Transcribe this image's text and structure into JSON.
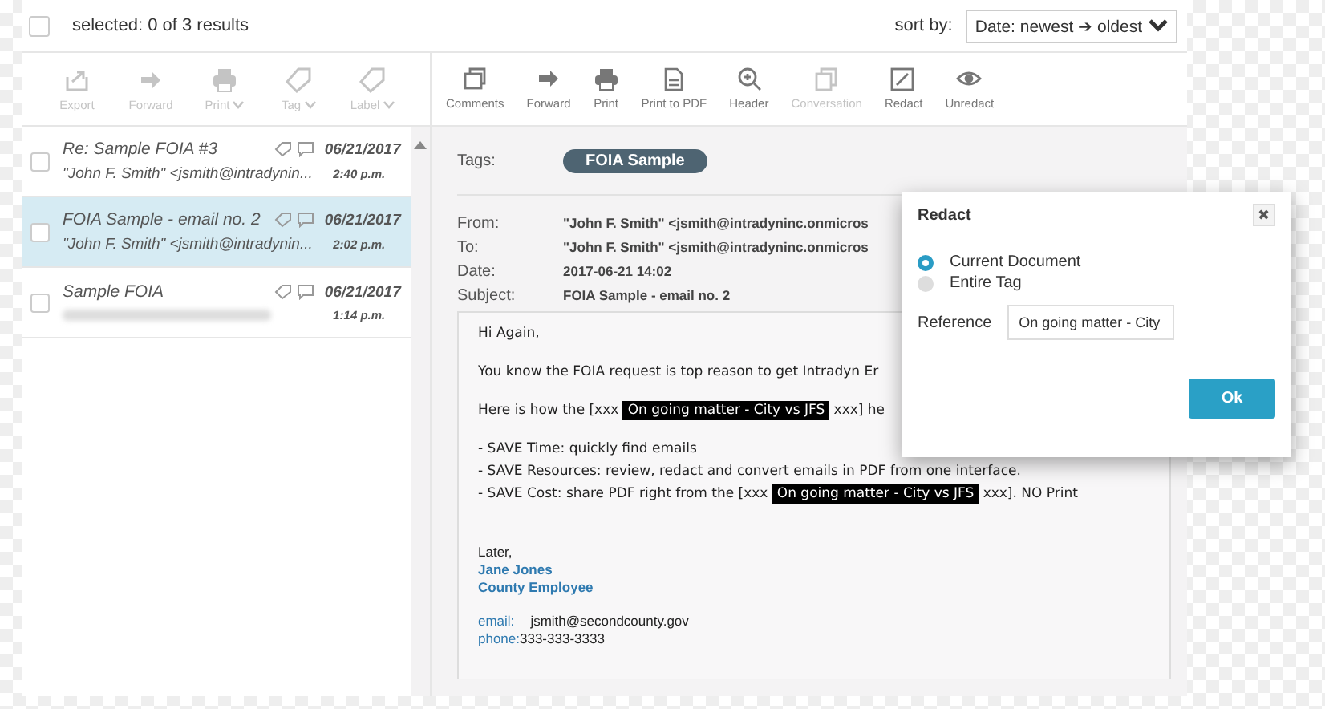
{
  "header": {
    "all_checked": false,
    "selection": "selected: 0 of 3 results",
    "sort_label": "sort by:",
    "sort_value": "Date: newest ➔ oldest"
  },
  "list_toolbar": [
    {
      "label": "Export",
      "disabled": true,
      "dropdown": false
    },
    {
      "label": "Forward",
      "disabled": true,
      "dropdown": false
    },
    {
      "label": "Print",
      "disabled": true,
      "dropdown": true
    },
    {
      "label": "Tag",
      "disabled": true,
      "dropdown": true
    },
    {
      "label": "Label",
      "disabled": true,
      "dropdown": true
    }
  ],
  "doc_toolbar": [
    {
      "label": "Comments",
      "disabled": false
    },
    {
      "label": "Forward",
      "disabled": false
    },
    {
      "label": "Print",
      "disabled": false
    },
    {
      "label": "Print to PDF",
      "disabled": false
    },
    {
      "label": "Header",
      "disabled": false
    },
    {
      "label": "Conversation",
      "disabled": true
    },
    {
      "label": "Redact",
      "disabled": false
    },
    {
      "label": "Unredact",
      "disabled": false
    }
  ],
  "emails": [
    {
      "subject": "Re: Sample FOIA #3",
      "sender": "\"John F. Smith\" <jsmith@intradynin...",
      "date": "06/21/2017",
      "time": "2:40 p.m.",
      "selected": false,
      "sender_blurred": false
    },
    {
      "subject": "FOIA Sample - email no. 2",
      "sender": "\"John F. Smith\" <jsmith@intradynin...",
      "date": "06/21/2017",
      "time": "2:02 p.m.",
      "selected": true,
      "sender_blurred": false
    },
    {
      "subject": "Sample FOIA",
      "date": "06/21/2017",
      "time": "1:14 p.m.",
      "selected": false,
      "sender_blurred": true
    }
  ],
  "document": {
    "tags_label": "Tags:",
    "tag": "FOIA Sample",
    "fields": [
      {
        "label": "From:",
        "value": "\"John F. Smith\" <jsmith@intradyninc.onmicros"
      },
      {
        "label": "To:",
        "value": "\"John F. Smith\" <jsmith@intradyninc.onmicros"
      },
      {
        "label": "Date:",
        "value": "2017-06-21 14:02"
      },
      {
        "label": "Subject:",
        "value": "FOIA Sample - email no. 2"
      }
    ],
    "body": [
      {
        "kind": "text",
        "parts": [
          {
            "text": "Hi Again,",
            "redacted": false
          }
        ]
      },
      {
        "kind": "text",
        "parts": [
          {
            "text": "You know the FOIA request is top reason to get Intradyn Er",
            "redacted": false
          }
        ]
      },
      {
        "kind": "text",
        "parts": [
          {
            "text": "Here is how the [xxx ",
            "redacted": false
          },
          {
            "text": "On going matter - City vs JFS",
            "redacted": true
          },
          {
            "text": " xxx] he",
            "redacted": false
          }
        ]
      },
      {
        "kind": "list",
        "items": [
          [
            {
              "text": "- SAVE Time: quickly find emails",
              "redacted": false
            }
          ],
          [
            {
              "text": "- SAVE Resources: review, redact and convert emails in PDF from one interface.",
              "redacted": false
            }
          ],
          [
            {
              "text": "- SAVE Cost: share PDF right from the [xxx ",
              "redacted": false
            },
            {
              "text": "On going matter - City vs JFS",
              "redacted": true
            },
            {
              "text": " xxx]. NO Print",
              "redacted": false
            }
          ]
        ]
      }
    ],
    "signature": {
      "closing": "Later,",
      "name": "Jane Jones",
      "title": "County Employee",
      "email_label": "email:",
      "email": "jsmith@secondcounty.gov",
      "phone_label": "phone:",
      "phone": "333-333-3333"
    }
  },
  "redact_dialog": {
    "title": "Redact",
    "close": "✖",
    "options": [
      {
        "label": "Current Document",
        "selected": true
      },
      {
        "label": "Entire Tag",
        "selected": false
      }
    ],
    "reference_label": "Reference",
    "reference_value": "On going matter - City",
    "ok": "Ok"
  }
}
